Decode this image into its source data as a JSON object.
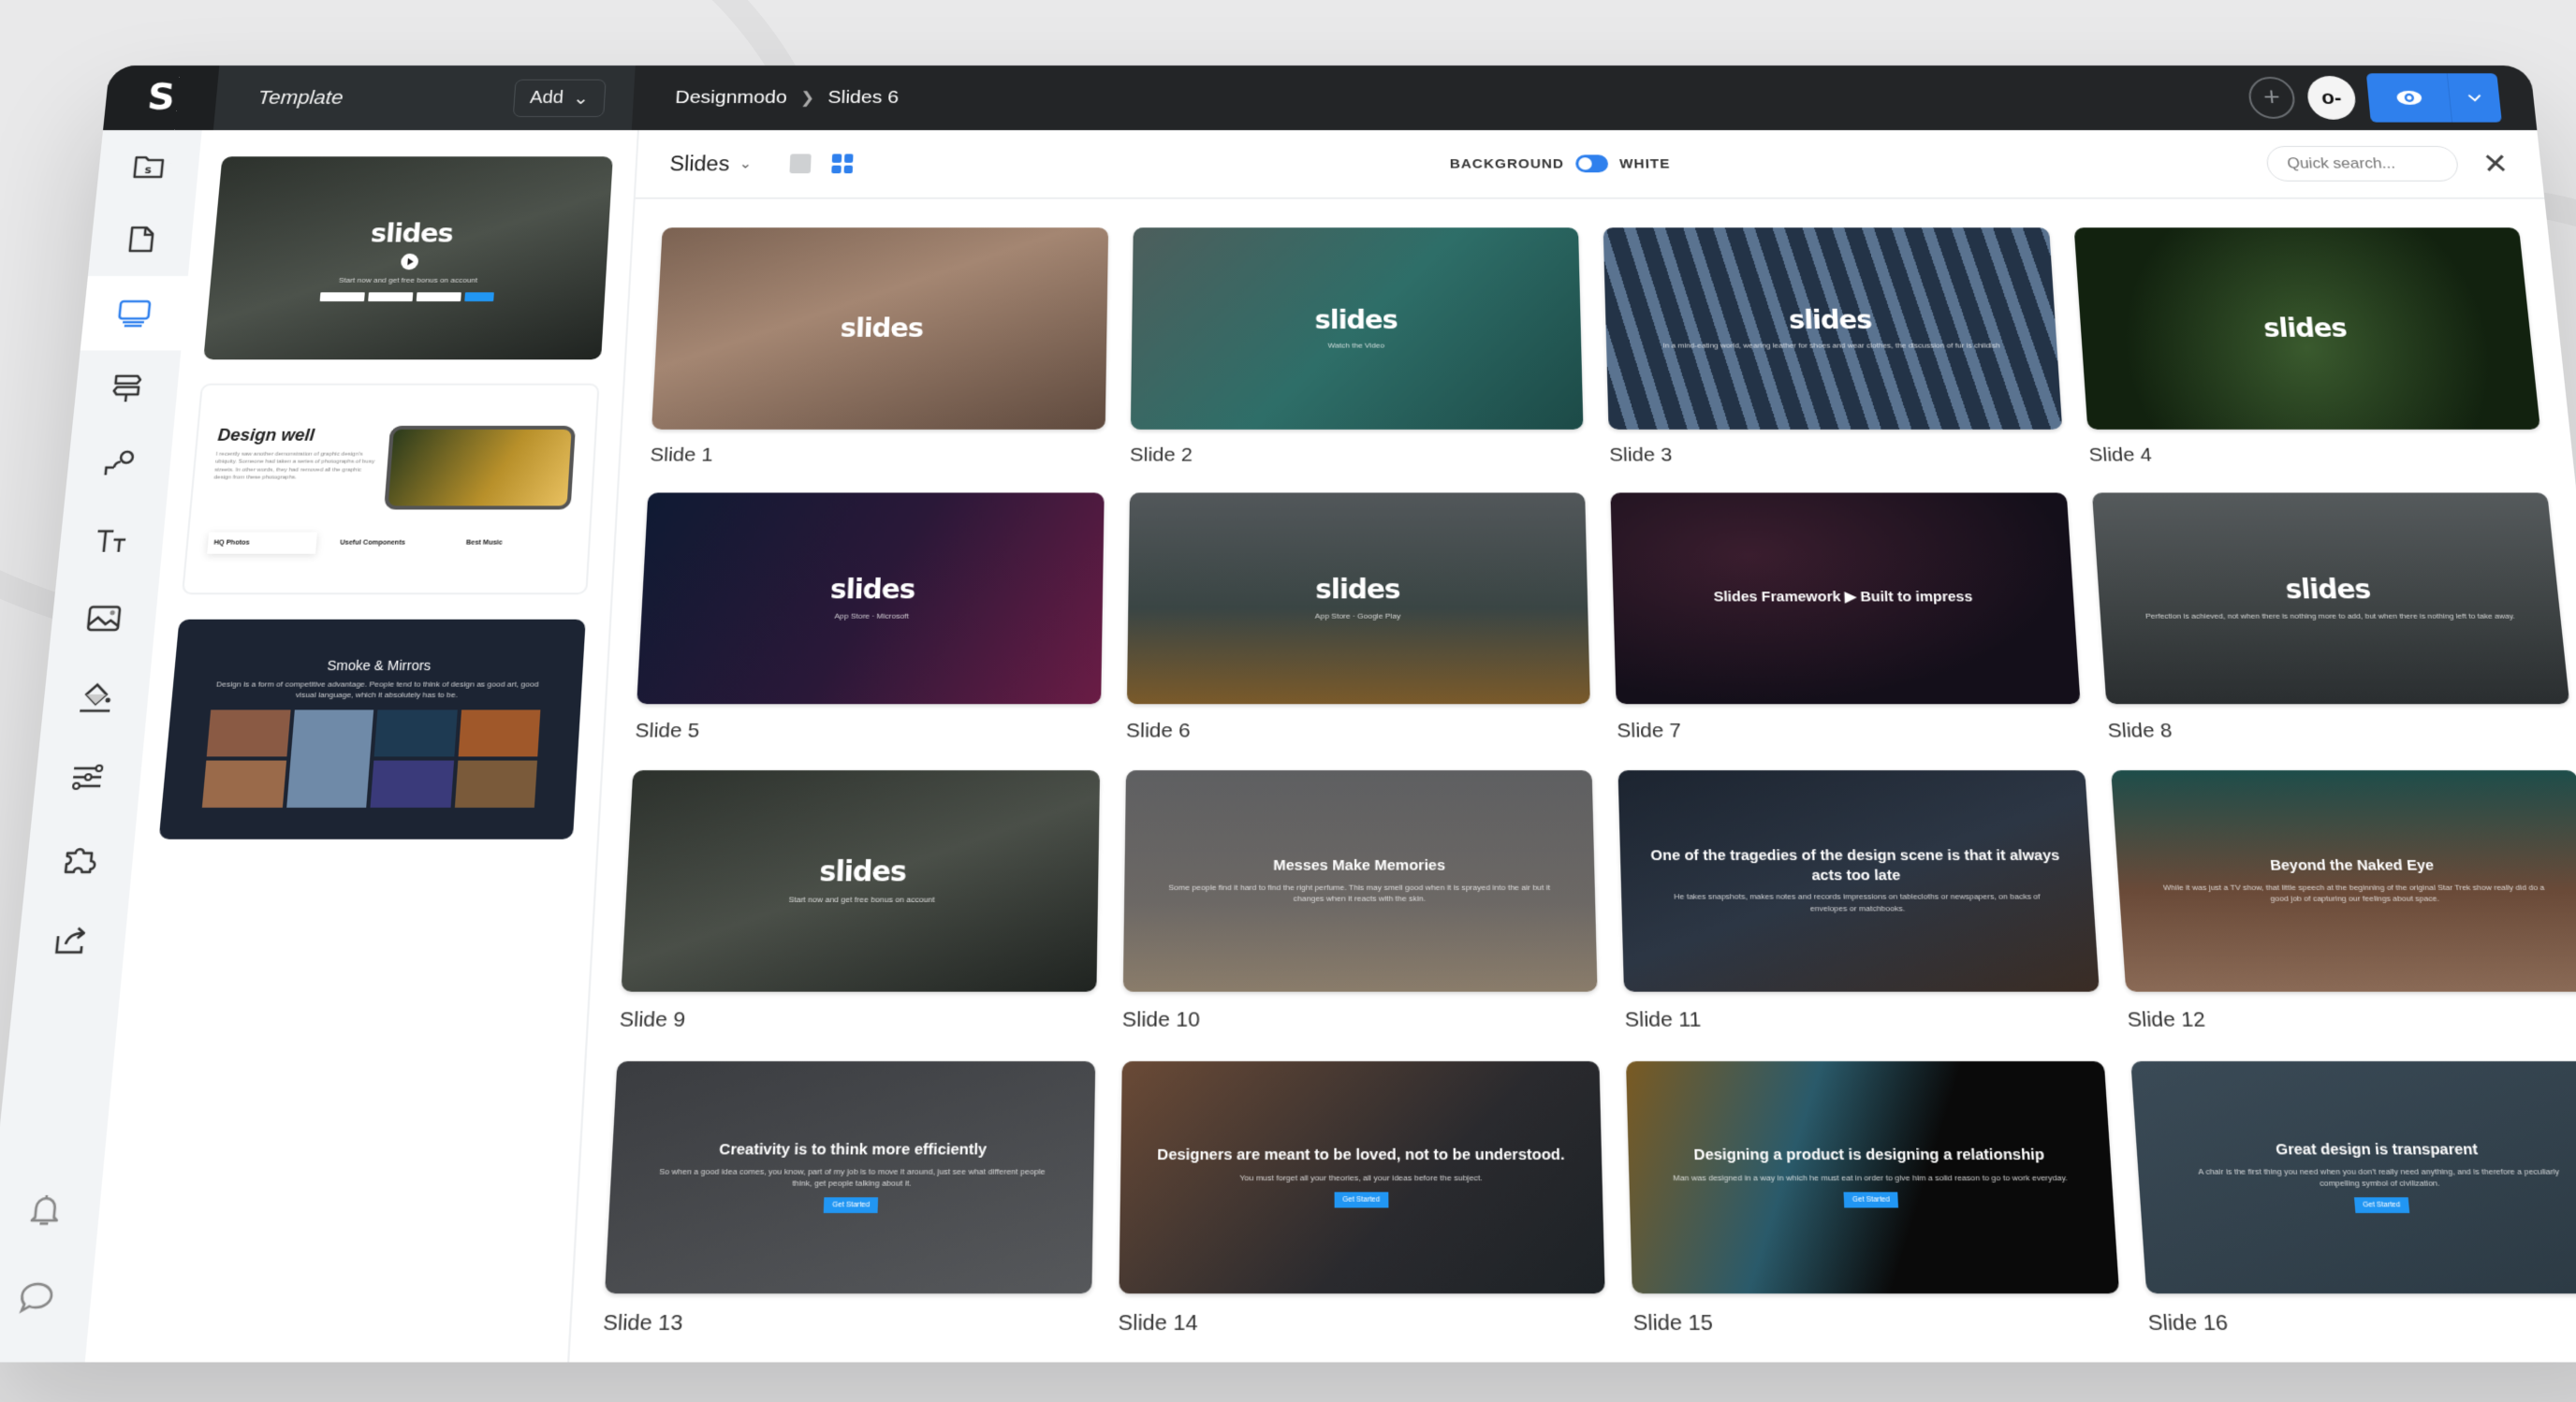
{
  "app": {
    "logo": "S",
    "project_title": "Template",
    "add_label": "Add",
    "breadcrumb": [
      "Designmodo",
      "Slides 6"
    ],
    "accent": "#2f80ed",
    "avatar_glyph": "o-"
  },
  "rail": {
    "items": [
      {
        "name": "project",
        "icon": "folder-s-icon"
      },
      {
        "name": "pages",
        "icon": "page-icon"
      },
      {
        "name": "slides",
        "icon": "monitor-icon",
        "active": true
      },
      {
        "name": "navigation",
        "icon": "signpost-icon"
      },
      {
        "name": "elements",
        "icon": "shapes-icon"
      },
      {
        "name": "typography",
        "icon": "text-size-icon"
      },
      {
        "name": "images",
        "icon": "image-icon"
      },
      {
        "name": "colors",
        "icon": "paint-bucket-icon"
      },
      {
        "name": "settings",
        "icon": "sliders-icon"
      },
      {
        "name": "plugins",
        "icon": "puzzle-icon"
      },
      {
        "name": "export",
        "icon": "share-icon"
      }
    ],
    "bottom": [
      {
        "name": "notifications",
        "icon": "bell-icon"
      },
      {
        "name": "chat",
        "icon": "chat-icon"
      }
    ]
  },
  "thumbs": [
    {
      "title": "slides",
      "caption": "Start now and get free bonus on account"
    },
    {
      "title": "Design well",
      "text": "I recently saw another demonstration of graphic design's ubiquity. Someone had taken a series of photographs of busy streets. In other words, they had removed all the graphic design from these photographs.",
      "features": [
        "HQ Photos",
        "Useful Components",
        "Best Music"
      ]
    },
    {
      "title": "Smoke & Mirrors",
      "text": "Design is a form of competitive advantage. People tend to think of design as good art, good visual language, which it absolutely has to be."
    }
  ],
  "toolbar": {
    "title": "Slides",
    "background_label": "BACKGROUND",
    "background_value": "WHITE",
    "search_placeholder": "Quick search..."
  },
  "slides": [
    {
      "label": "Slide 1",
      "heading": "slides",
      "bg": "linear-gradient(160deg,#7b6252,#a48672 40%,#5f4a3e)"
    },
    {
      "label": "Slide 2",
      "heading": "slides",
      "sub": "Watch the Video",
      "bg": "linear-gradient(135deg,#4d5e5c,#2e6e68 50%,#1c4a47)"
    },
    {
      "label": "Slide 3",
      "heading": "slides",
      "sub": "In a mind-eating world, wearing leather for shoes and wear clothes, the discussion of fur is childish",
      "bg": "repeating-linear-gradient(75deg,#233347 0 18px,#5a7390 18px 30px)"
    },
    {
      "label": "Slide 4",
      "heading": "slides",
      "bg": "radial-gradient(circle at 50% 60%,#3a5a2e,#12220f 70%)"
    },
    {
      "label": "Slide 5",
      "heading": "slides",
      "sub": "App Store · Microsoft",
      "bg": "linear-gradient(120deg,#0f1a33,#2a1838 50%,#6a1c45)"
    },
    {
      "label": "Slide 6",
      "heading": "slides",
      "sub": "App Store · Google Play",
      "bg": "linear-gradient(180deg,#52575a,#3a4544 55%,#7a5a2a)"
    },
    {
      "label": "Slide 7",
      "heading": "Slides Framework ▶ Built to impress",
      "bg": "radial-gradient(ellipse at 30% 30%,#3a1d2e,#140f1a 70%)"
    },
    {
      "label": "Slide 8",
      "heading": "slides",
      "sub": "Perfection is achieved, not when there is nothing more to add, but when there is nothing left to take away.",
      "bg": "linear-gradient(180deg,#555a5c,#3c4142 60%,#2a2e30)"
    },
    {
      "label": "Slide 9",
      "heading": "slides",
      "sub": "Start now and get free bonus on account",
      "bg": "linear-gradient(160deg,#2c312c,#4a4f48 50%,#1f2320)"
    },
    {
      "label": "Slide 10",
      "heading": "Messes Make Memories",
      "sub": "Some people find it hard to find the right perfume. This may smell good when it is sprayed into the air but it changes when it reacts with the skin.",
      "bg": "linear-gradient(180deg,#5e5f61,#6c6865 60%,#8a7c6a)"
    },
    {
      "label": "Slide 11",
      "heading": "One of the tragedies of the design scene is that it always acts too late",
      "sub": "He takes snapshots, makes notes and records impressions on tablecloths or newspapers, on backs of envelopes or matchbooks.",
      "bg": "linear-gradient(160deg,#1c2430,#2c3644 50%,#3a2c24)"
    },
    {
      "label": "Slide 12",
      "heading": "Beyond the Naked Eye",
      "sub": "While it was just a TV show, that little speech at the beginning of the original Star Trek show really did do a good job of capturing our feelings about space.",
      "bg": "linear-gradient(180deg,#1e4d4a,#6a4a38 55%,#8a6a56)"
    },
    {
      "label": "Slide 13",
      "heading": "Creativity is to think more efficiently",
      "sub": "So when a good idea comes, you know, part of my job is to move it around, just see what different people think, get people talking about it.",
      "bg": "linear-gradient(160deg,#3a3c40,#56585b)"
    },
    {
      "label": "Slide 14",
      "heading": "Designers are meant to be loved, not to be understood.",
      "sub": "You must forget all your theories, all your ideas before the subject.",
      "bg": "linear-gradient(135deg,#6a4a36,#2a2a2e 60%,#1d2226)"
    },
    {
      "label": "Slide 15",
      "heading": "Designing a product is designing a relationship",
      "sub": "Man was designed in a way in which he must eat in order to give him a solid reason to go to work everyday.",
      "bg": "linear-gradient(110deg,#7a5a22,#2a5a6a 35%,#0a0a0a 60%)"
    },
    {
      "label": "Slide 16",
      "heading": "Great design is transparent",
      "sub": "A chair is the first thing you need when you don't really need anything, and is therefore a peculiarly compelling symbol of civilization.",
      "bg": "linear-gradient(160deg,#3a4a56,#2c3a44)"
    }
  ],
  "common": {
    "cta": "Get Started"
  }
}
